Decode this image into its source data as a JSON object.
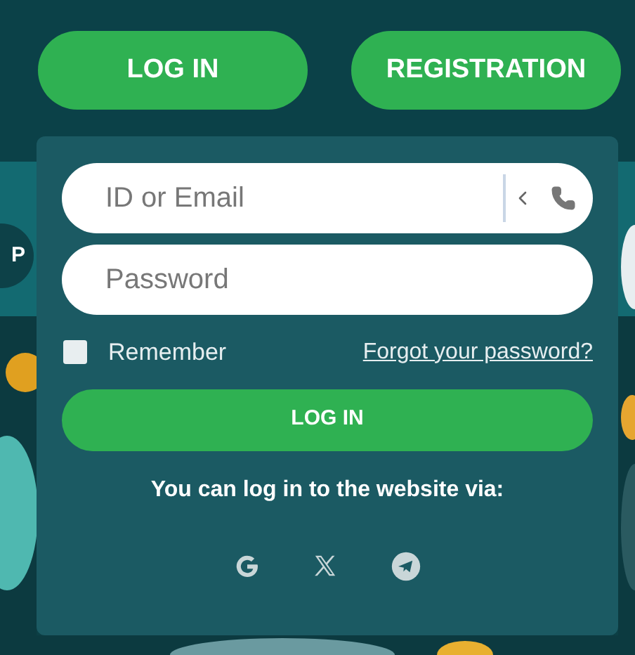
{
  "header": {
    "buttons": [
      "LOG IN",
      "REGISTRATION"
    ]
  },
  "background": {
    "badge": "P"
  },
  "login_form": {
    "id_field": {
      "placeholder": "ID or Email"
    },
    "password_field": {
      "placeholder": "Password"
    },
    "remember": {
      "label": "Remember",
      "checked": false
    },
    "forgot_link": "Forgot your password?",
    "submit": "LOG IN",
    "via_text": "You can log in to the website via:",
    "social": [
      {
        "kind": "google"
      },
      {
        "kind": "x"
      },
      {
        "kind": "telegram"
      }
    ]
  }
}
